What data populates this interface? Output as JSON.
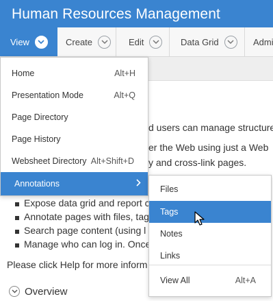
{
  "header": {
    "title": "Human Resources Management"
  },
  "menubar": {
    "tabs": [
      {
        "label": "View"
      },
      {
        "label": "Create"
      },
      {
        "label": "Edit"
      },
      {
        "label": "Data Grid"
      },
      {
        "label": "Admi"
      }
    ]
  },
  "background": {
    "line1": "d users can manage structure",
    "line2": "er the Web using just a Web",
    "line3": "y and cross-link pages.",
    "bullet1": "Expose data grid and report c",
    "bullet2": "Annotate pages with files, tag",
    "bullet3": "Search page content (using l",
    "bullet4": "Manage who can log in. Once",
    "help": "Please click Help for more inform",
    "overview": "Overview"
  },
  "view_menu": {
    "items": [
      {
        "label": "Home",
        "shortcut": "Alt+H"
      },
      {
        "label": "Presentation Mode",
        "shortcut": "Alt+Q"
      },
      {
        "label": "Page Directory",
        "shortcut": ""
      },
      {
        "label": "Page History",
        "shortcut": ""
      },
      {
        "label": "Websheet Directory",
        "shortcut": "Alt+Shift+D"
      },
      {
        "label": "Annotations",
        "shortcut": ""
      }
    ]
  },
  "annotations_submenu": {
    "items": [
      {
        "label": "Files",
        "shortcut": ""
      },
      {
        "label": "Tags",
        "shortcut": ""
      },
      {
        "label": "Notes",
        "shortcut": ""
      },
      {
        "label": "Links",
        "shortcut": ""
      },
      {
        "label": "View All",
        "shortcut": "Alt+A"
      }
    ]
  },
  "colors": {
    "accent": "#3a84d0",
    "menubar_bg": "#f7f7f7"
  }
}
